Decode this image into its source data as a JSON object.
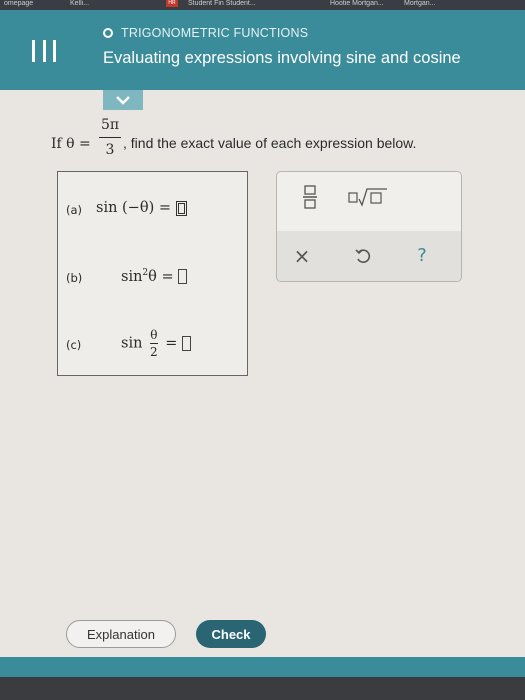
{
  "browser_tabs": [
    "omepage",
    "Kelli...",
    "Student Fin Student...",
    "Hootie Mortgan...",
    "Mortgan..."
  ],
  "browser_badge": "HR",
  "header": {
    "topic": "TRIGONOMETRIC FUNCTIONS",
    "title": "Evaluating expressions involving sine and cosine"
  },
  "problem": {
    "if_text": "If θ =",
    "theta_numerator": "5π",
    "theta_denominator": "3",
    "instruction": ", find the exact value of each expression below."
  },
  "parts": [
    {
      "label": "(a)",
      "expr_prefix": "sin (−θ) ="
    },
    {
      "label": "(b)",
      "expr_prefix": "sin",
      "superscript": "2",
      "expr_suffix": "θ ="
    },
    {
      "label": "(c)",
      "expr_prefix": "sin",
      "frac_num": "θ",
      "frac_den": "2",
      "expr_suffix": "="
    }
  ],
  "keypad": {
    "keys": [
      "fraction-icon",
      "sqrt-icon",
      "clear-x-icon",
      "undo-icon",
      "help-icon"
    ],
    "clear_glyph": "×",
    "help_glyph": "?"
  },
  "buttons": {
    "explanation": "Explanation",
    "check": "Check"
  },
  "colors": {
    "header": "#3a8c9a",
    "check_button": "#2a6574",
    "background": "#e9e6e1"
  }
}
